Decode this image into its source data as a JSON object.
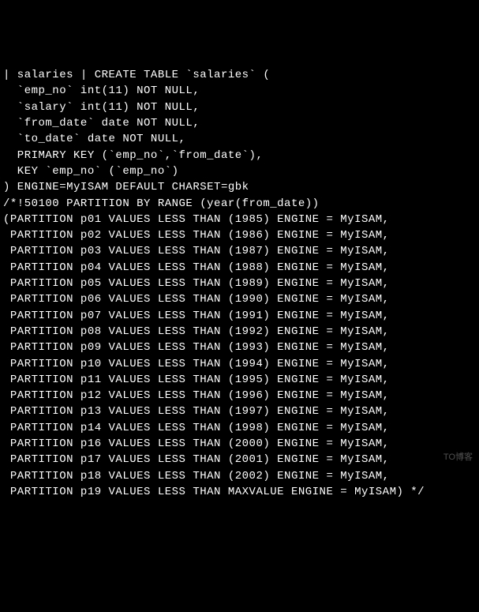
{
  "terminal": {
    "lines": [
      "| salaries | CREATE TABLE `salaries` (",
      "  `emp_no` int(11) NOT NULL,",
      "  `salary` int(11) NOT NULL,",
      "  `from_date` date NOT NULL,",
      "  `to_date` date NOT NULL,",
      "  PRIMARY KEY (`emp_no`,`from_date`),",
      "  KEY `emp_no` (`emp_no`)",
      ") ENGINE=MyISAM DEFAULT CHARSET=gbk",
      "/*!50100 PARTITION BY RANGE (year(from_date))",
      "(PARTITION p01 VALUES LESS THAN (1985) ENGINE = MyISAM,",
      " PARTITION p02 VALUES LESS THAN (1986) ENGINE = MyISAM,",
      " PARTITION p03 VALUES LESS THAN (1987) ENGINE = MyISAM,",
      " PARTITION p04 VALUES LESS THAN (1988) ENGINE = MyISAM,",
      " PARTITION p05 VALUES LESS THAN (1989) ENGINE = MyISAM,",
      " PARTITION p06 VALUES LESS THAN (1990) ENGINE = MyISAM,",
      " PARTITION p07 VALUES LESS THAN (1991) ENGINE = MyISAM,",
      " PARTITION p08 VALUES LESS THAN (1992) ENGINE = MyISAM,",
      " PARTITION p09 VALUES LESS THAN (1993) ENGINE = MyISAM,",
      " PARTITION p10 VALUES LESS THAN (1994) ENGINE = MyISAM,",
      " PARTITION p11 VALUES LESS THAN (1995) ENGINE = MyISAM,",
      " PARTITION p12 VALUES LESS THAN (1996) ENGINE = MyISAM,",
      " PARTITION p13 VALUES LESS THAN (1997) ENGINE = MyISAM,",
      " PARTITION p14 VALUES LESS THAN (1998) ENGINE = MyISAM,",
      " PARTITION p16 VALUES LESS THAN (2000) ENGINE = MyISAM,",
      " PARTITION p17 VALUES LESS THAN (2001) ENGINE = MyISAM,",
      " PARTITION p18 VALUES LESS THAN (2002) ENGINE = MyISAM,",
      " PARTITION p19 VALUES LESS THAN MAXVALUE ENGINE = MyISAM) */"
    ]
  },
  "watermark": "TO博客"
}
